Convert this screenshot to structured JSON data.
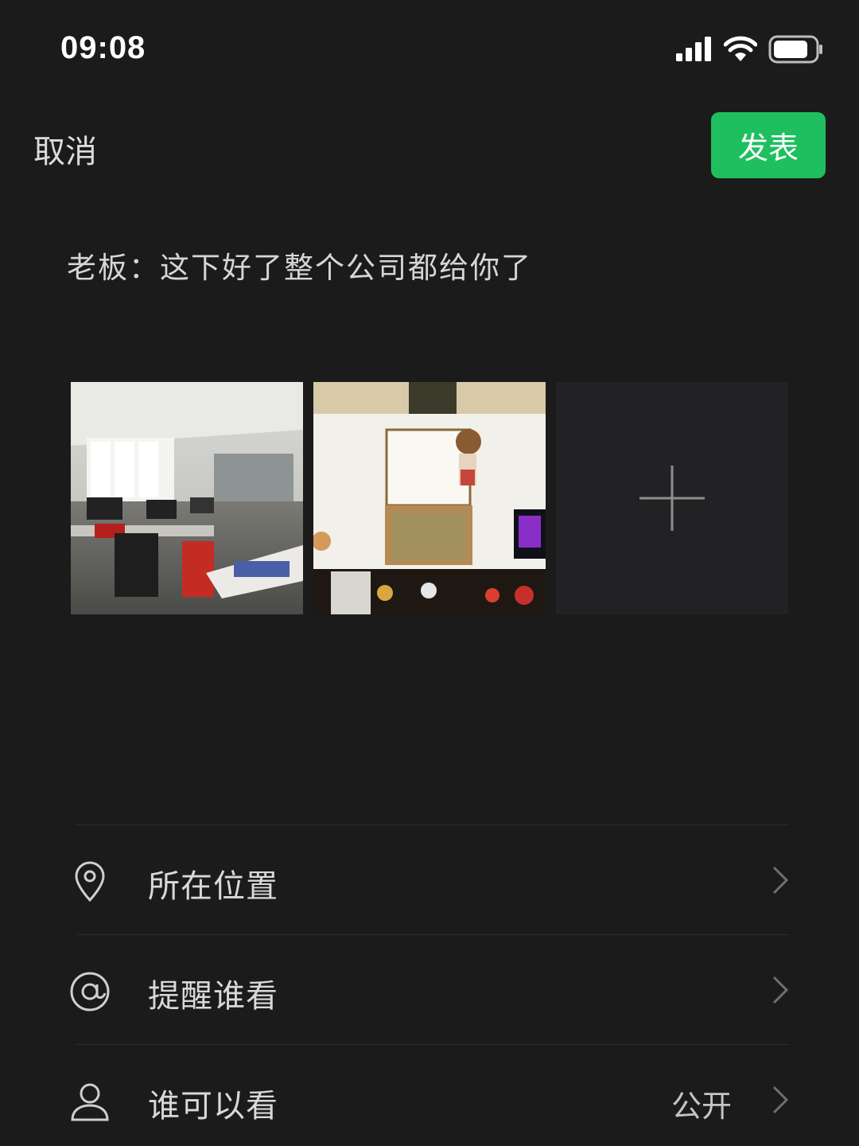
{
  "status_bar": {
    "time": "09:08",
    "icons": [
      "signal-icon",
      "wifi-icon",
      "battery-icon"
    ]
  },
  "nav": {
    "cancel_label": "取消",
    "publish_label": "发表",
    "publish_color": "#1fbf5f"
  },
  "post": {
    "text": "老板：这下好了整个公司都给你了"
  },
  "photos": [
    {
      "name": "office-photo",
      "description_icon": "photo"
    },
    {
      "name": "desk-photo",
      "description_icon": "photo"
    }
  ],
  "add_photo_icon": "plus-icon",
  "settings": {
    "location": {
      "label": "所在位置",
      "icon": "location-pin-icon"
    },
    "remind": {
      "label": "提醒谁看",
      "icon": "at-icon"
    },
    "visibility": {
      "label": "谁可以看",
      "value": "公开",
      "icon": "person-icon"
    }
  }
}
